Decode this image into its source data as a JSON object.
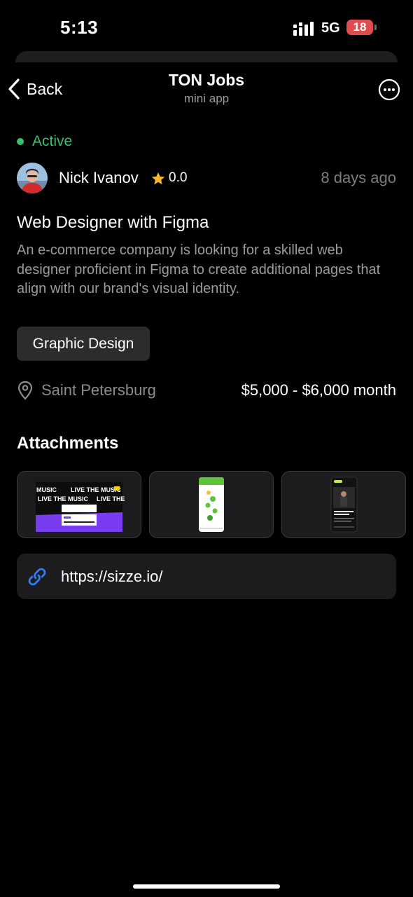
{
  "status_bar": {
    "time": "5:13",
    "network": "5G",
    "battery": "18"
  },
  "nav": {
    "back_label": "Back",
    "title": "TON Jobs",
    "subtitle": "mini app"
  },
  "job": {
    "status": "Active",
    "author": "Nick Ivanov",
    "rating": "0.0",
    "posted": "8 days ago",
    "title": "Web Designer with Figma",
    "description": "An e-commerce company is looking for a skilled web designer proficient in Figma to create additional pages that align with our brand's visual identity.",
    "tag": "Graphic Design",
    "location": "Saint Petersburg",
    "salary": "$5,000 - $6,000 month"
  },
  "attachments": {
    "title": "Attachments",
    "thumb1_text": {
      "left_top": "MUSIC",
      "right_top": "LIVE THE MUSIC",
      "left_bottom": "LIVE THE MUSIC",
      "right_bottom": "LIVE THE"
    }
  },
  "link": {
    "url": "https://sizze.io/"
  },
  "colors": {
    "accent_green": "#36c26b",
    "link_blue": "#2e7cf6",
    "star": "#f5b731",
    "battery": "#e04b4b"
  }
}
